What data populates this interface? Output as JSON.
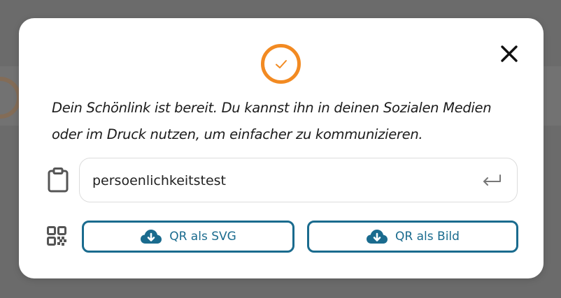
{
  "dialog": {
    "message": "Dein Schönlink ist bereit. Du kannst ihn in deinen Sozialen Medien oder im Druck nutzen, um einfacher zu kommunizieren.",
    "link_value": "persoenlichkeitstest",
    "buttons": {
      "qr_svg": "QR als SVG",
      "qr_image": "QR als Bild"
    },
    "icons": {
      "success": "checkmark-circle-icon",
      "close": "close-icon",
      "clipboard": "clipboard-icon",
      "enter": "enter-return-icon",
      "qr": "qr-code-icon",
      "download": "cloud-download-icon"
    }
  },
  "colors": {
    "accent_orange": "#f28a22",
    "button_blue": "#1a6b8e",
    "overlay": "#6b6b6b"
  }
}
